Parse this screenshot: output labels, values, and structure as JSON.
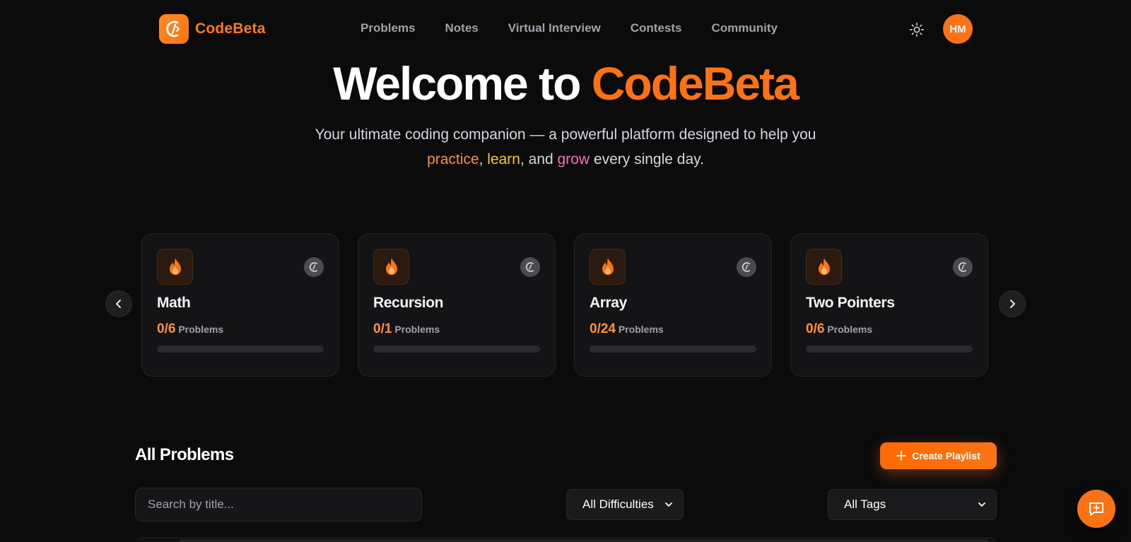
{
  "header": {
    "brand": "CodeBeta",
    "nav": [
      "Problems",
      "Notes",
      "Virtual Interview",
      "Contests",
      "Community"
    ],
    "avatar_initials": "HM",
    "accent": "#f97316"
  },
  "hero": {
    "title_prefix": "Welcome to ",
    "title_brand": "CodeBeta",
    "subtitle_line1": "Your ultimate coding companion — a powerful platform designed to help you",
    "practice": "practice",
    "comma1": ", ",
    "learn": "learn",
    "and_text": ", and ",
    "grow": "grow",
    "tail": " every single day."
  },
  "cards": [
    {
      "title": "Math",
      "solved": "0/6",
      "suffix": "Problems",
      "progress": 0
    },
    {
      "title": "Recursion",
      "solved": "0/1",
      "suffix": "Problems",
      "progress": 0
    },
    {
      "title": "Array",
      "solved": "0/24",
      "suffix": "Problems",
      "progress": 0
    },
    {
      "title": "Two Pointers",
      "solved": "0/6",
      "suffix": "Problems",
      "progress": 0
    }
  ],
  "problems": {
    "title": "All Problems",
    "create_label": "Create Playlist",
    "search_placeholder": "Search by title...",
    "difficulty_selected": "All Difficulties",
    "tags_selected": "All Tags"
  },
  "icons": {
    "theme": "sun-icon",
    "prev": "chevron-left-icon",
    "next": "chevron-right-icon",
    "card": "fire-icon",
    "badge": "codebeta-logo-icon",
    "chat": "chat-plus-icon",
    "select": "chevron-down-icon"
  }
}
